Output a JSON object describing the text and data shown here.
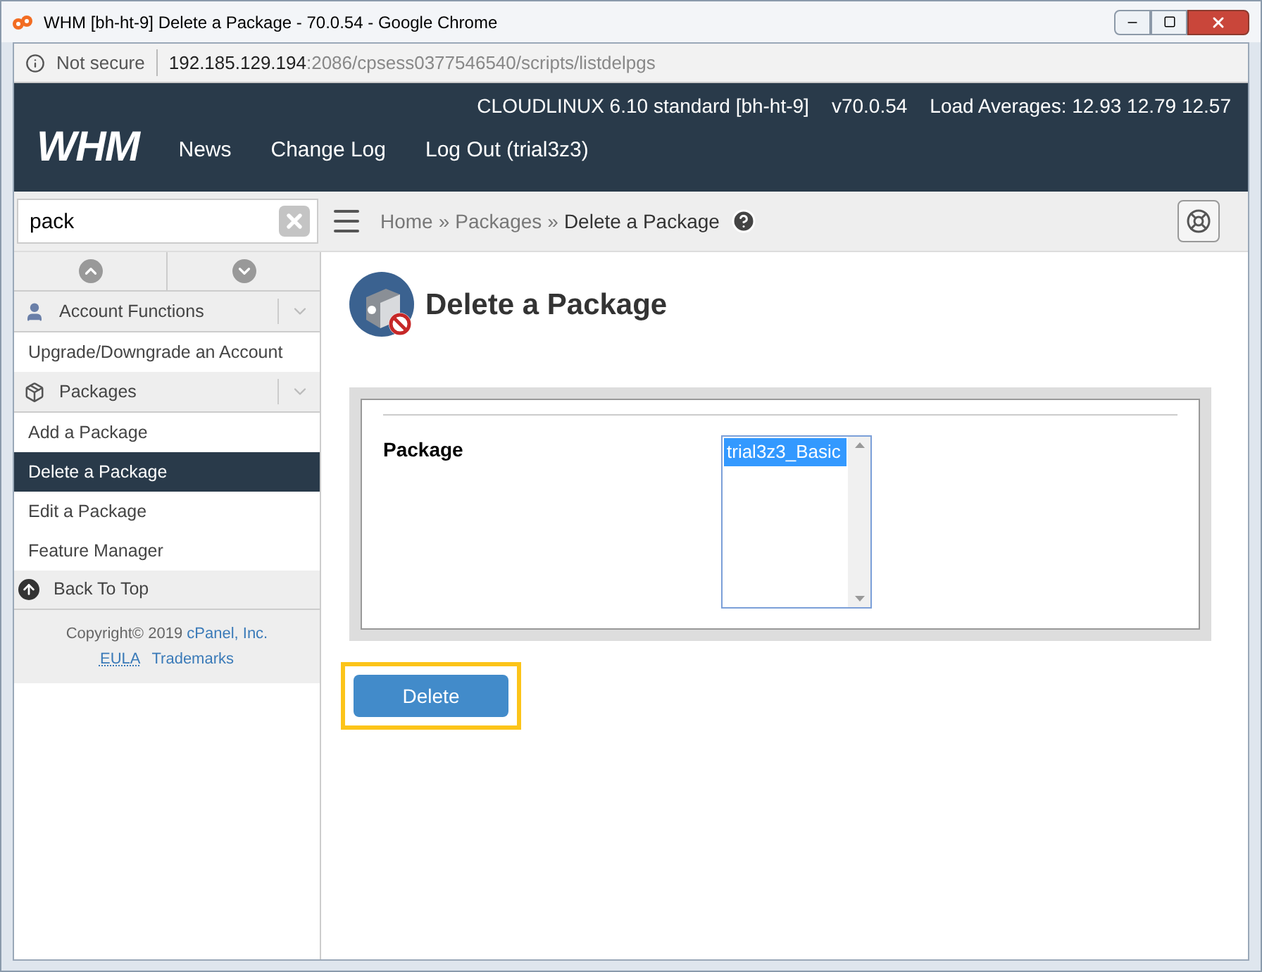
{
  "window": {
    "title": "WHM [bh-ht-9] Delete a Package - 70.0.54 - Google Chrome"
  },
  "address_bar": {
    "security": "Not secure",
    "host": "192.185.129.194",
    "path": ":2086/cpsess0377546540/scripts/listdelpgs"
  },
  "header": {
    "logo": "WHM",
    "server_info": [
      "CLOUDLINUX 6.10 standard [bh-ht-9]",
      "v70.0.54",
      "Load Averages: 12.93 12.79 12.57"
    ],
    "nav": [
      "News",
      "Change Log",
      "Log Out (trial3z3)"
    ]
  },
  "search": {
    "value": "pack"
  },
  "breadcrumb": {
    "items": [
      "Home",
      "Packages",
      "Delete a Package"
    ],
    "separator": "»"
  },
  "sidebar": {
    "sections": [
      {
        "title": "Account Functions",
        "items": [
          {
            "label": "Upgrade/Downgrade an Account",
            "selected": false
          }
        ]
      },
      {
        "title": "Packages",
        "items": [
          {
            "label": "Add a Package",
            "selected": false
          },
          {
            "label": "Delete a Package",
            "selected": true
          },
          {
            "label": "Edit a Package",
            "selected": false
          },
          {
            "label": "Feature Manager",
            "selected": false
          }
        ]
      }
    ],
    "back_to_top": "Back To Top",
    "footer": {
      "copyright": "Copyright© 2019",
      "company": "cPanel, Inc.",
      "links": [
        "EULA",
        "Trademarks"
      ]
    }
  },
  "page": {
    "title": "Delete a Package",
    "field_label": "Package",
    "options": [
      {
        "label": "trial3z3_Basic",
        "selected": true
      }
    ],
    "button": "Delete"
  }
}
